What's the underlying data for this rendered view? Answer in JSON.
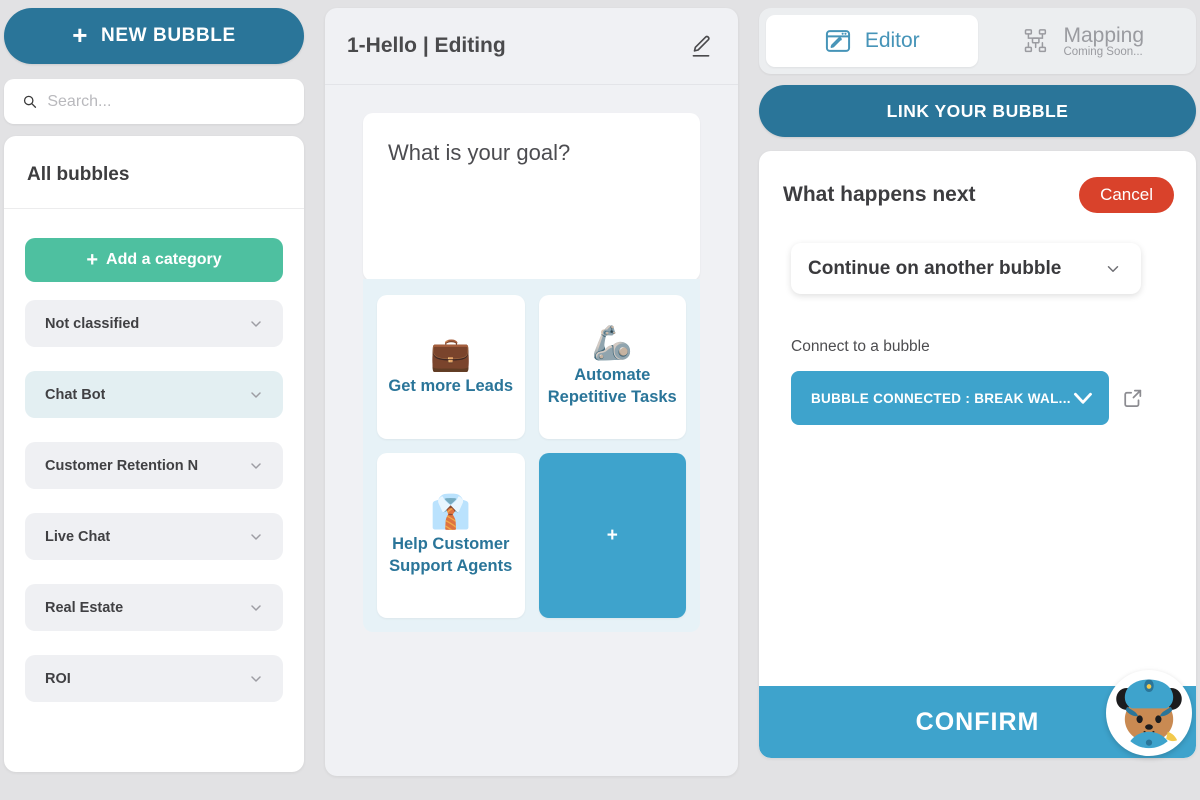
{
  "colors": {
    "primary_dark_blue": "#2a7599",
    "primary_light_blue": "#3ea3cc",
    "green": "#4ec0a0",
    "red": "#d9422b",
    "page_bg": "#e2e2e4",
    "panel_bg": "#f0f1f4",
    "choice_area_bg": "#e7f2f7"
  },
  "sidebar": {
    "new_bubble_label": "NEW BUBBLE",
    "new_bubble_icon": "plus-icon",
    "search": {
      "placeholder": "Search...",
      "value": "",
      "icon": "search-icon"
    },
    "panel_title": "All bubbles",
    "add_category_label": "Add a category",
    "add_category_icon": "plus-icon",
    "categories": [
      {
        "label": "Not classified",
        "selected": false,
        "icon": "chevron-down-icon"
      },
      {
        "label": "Chat Bot",
        "selected": true,
        "icon": "chevron-down-icon"
      },
      {
        "label": "Customer Retention N",
        "selected": false,
        "icon": "chevron-down-icon"
      },
      {
        "label": "Live Chat",
        "selected": false,
        "icon": "chevron-down-icon"
      },
      {
        "label": "Real Estate",
        "selected": false,
        "icon": "chevron-down-icon"
      },
      {
        "label": "ROI",
        "selected": false,
        "icon": "chevron-down-icon"
      }
    ]
  },
  "middle": {
    "title": "1-Hello | Editing",
    "edit_icon": "pencil-icon",
    "goal_message": "What is your goal?",
    "choices": [
      {
        "emoji": "💼",
        "emoji_name": "briefcase-emoji",
        "label": "Get more Leads"
      },
      {
        "emoji": "🦾",
        "emoji_name": "mechanical-arm-emoji",
        "label": "Automate Repetitive Tasks"
      },
      {
        "emoji": "👔",
        "emoji_name": "necktie-emoji",
        "label": "Help Customer Support Agents"
      }
    ],
    "add_choice_label": "+"
  },
  "right": {
    "tabs": [
      {
        "label": "Editor",
        "sub": "",
        "icon": "window-pencil-icon",
        "active": true
      },
      {
        "label": "Mapping",
        "sub": "Coming Soon...",
        "icon": "sitemap-icon",
        "active": false
      }
    ],
    "link_bubble_label": "LINK YOUR BUBBLE",
    "next_panel": {
      "title": "What happens next",
      "cancel_label": "Cancel",
      "action_select": {
        "value": "Continue on another bubble",
        "icon": "chevron-down-icon"
      },
      "connect_label": "Connect to a bubble",
      "connected_bubble": {
        "label": "BUBBLE CONNECTED : BREAK WAL...",
        "icon": "chevron-down-icon",
        "open_icon": "external-link-icon"
      },
      "confirm_label": "CONFIRM"
    },
    "mascot_icon": "chat-mascot-avatar"
  }
}
